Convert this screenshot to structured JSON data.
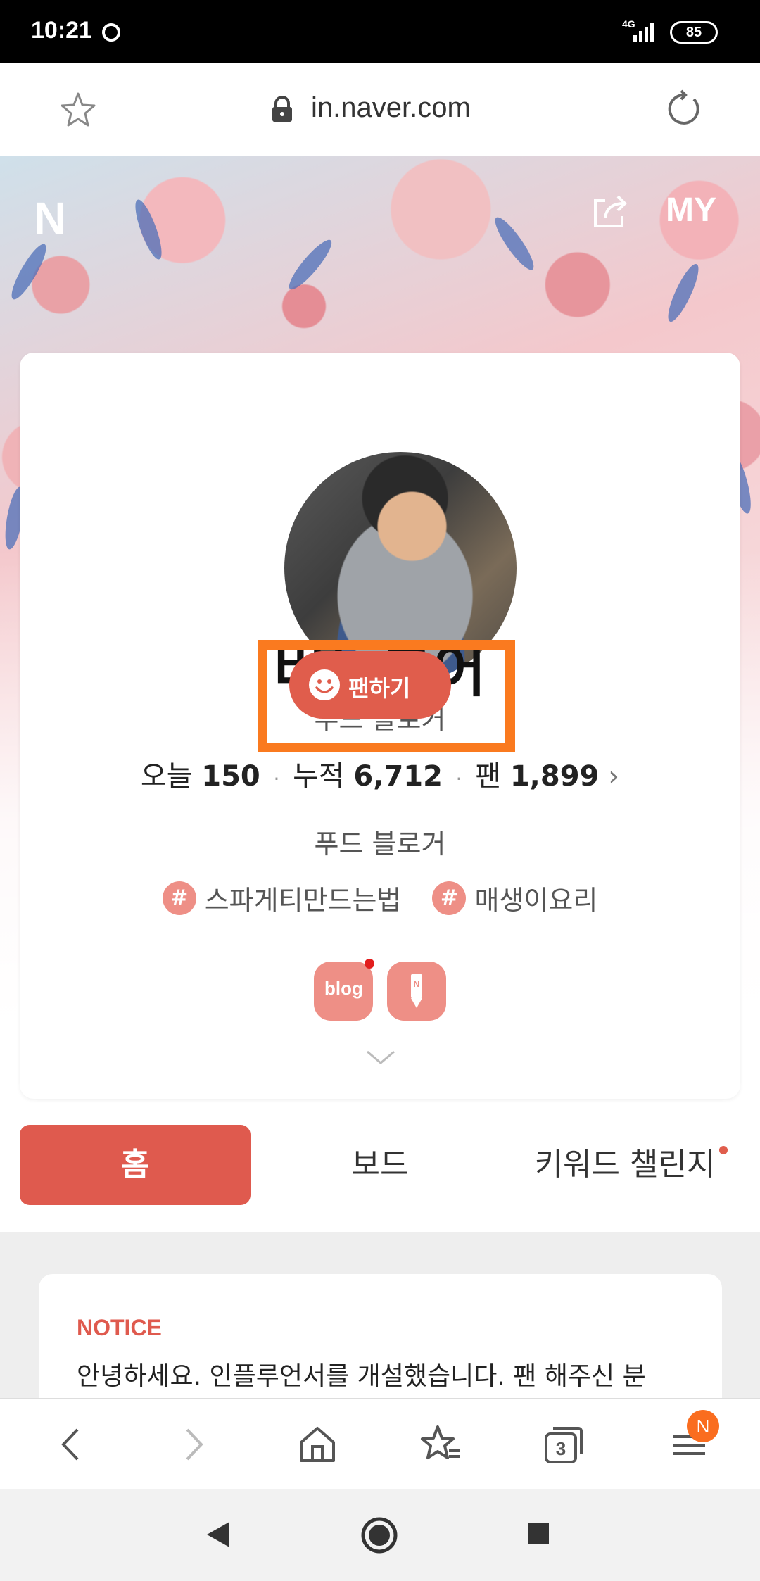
{
  "status_bar": {
    "time": "10:21",
    "network": "4G",
    "battery": "85"
  },
  "browser": {
    "url": "in.naver.com"
  },
  "header": {
    "logo": "N",
    "my_label": "MY"
  },
  "profile": {
    "name": "버들붕어",
    "subtitle": "푸드 블로거",
    "fan_button_label": "팬하기",
    "stats": {
      "today_label": "오늘",
      "today_value": "150",
      "total_label": "누적",
      "total_value": "6,712",
      "fans_label": "팬",
      "fans_value": "1,899"
    },
    "description": "푸드 블로거",
    "tags": [
      "스파게티만드는법",
      "매생이요리"
    ],
    "blog_icon_label": "blog",
    "second_icon_label": "N"
  },
  "tabs": {
    "home": "홈",
    "board": "보드",
    "keyword": "키워드 챌린지"
  },
  "notice": {
    "title": "NOTICE",
    "text": "안녕하세요. 인플루언서를 개설했습니다. 팬 해주신 분"
  },
  "bottom_nav": {
    "tab_count": "3",
    "menu_badge": "N"
  },
  "colors": {
    "accent": "#df5a4e",
    "highlight_box": "#fa7a1f",
    "tag_bg": "#ee8f86"
  }
}
